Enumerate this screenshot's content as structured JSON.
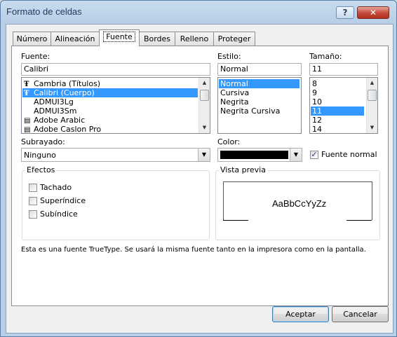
{
  "window": {
    "title": "Formato de celdas",
    "help_glyph": "?",
    "close_glyph": "✕"
  },
  "tabs": [
    "Número",
    "Alineación",
    "Fuente",
    "Bordes",
    "Relleno",
    "Proteger"
  ],
  "font": {
    "label": "Fuente:",
    "value": "Calibri",
    "items": [
      {
        "text": "Cambria (Títulos)",
        "icon": "truetype-icon",
        "glyph": "Ŧ",
        "selected": false
      },
      {
        "text": "Calibri (Cuerpo)",
        "icon": "truetype-icon",
        "glyph": "Ŧ",
        "selected": true
      },
      {
        "text": "ADMUI3Lg",
        "icon": "",
        "glyph": "",
        "selected": false
      },
      {
        "text": "ADMUI3Sm",
        "icon": "",
        "glyph": "",
        "selected": false
      },
      {
        "text": "Adobe Arabic",
        "icon": "printer-font-icon",
        "glyph": "▤",
        "selected": false
      },
      {
        "text": "Adobe Caslon Pro",
        "icon": "printer-font-icon",
        "glyph": "▤",
        "selected": false
      }
    ]
  },
  "style": {
    "label": "Estilo:",
    "value": "Normal",
    "items": [
      {
        "text": "Normal",
        "selected": true
      },
      {
        "text": "Cursiva",
        "selected": false
      },
      {
        "text": "Negrita",
        "selected": false
      },
      {
        "text": "Negrita Cursiva",
        "selected": false
      }
    ]
  },
  "size": {
    "label": "Tamaño:",
    "value": "11",
    "items": [
      {
        "text": "8",
        "selected": false
      },
      {
        "text": "9",
        "selected": false
      },
      {
        "text": "10",
        "selected": false
      },
      {
        "text": "11",
        "selected": true
      },
      {
        "text": "12",
        "selected": false
      },
      {
        "text": "14",
        "selected": false
      }
    ]
  },
  "underline": {
    "label": "Subrayado:",
    "value": "Ninguno"
  },
  "color": {
    "label": "Color:",
    "value_hex": "#000000"
  },
  "normal_font": {
    "label": "Fuente normal",
    "checked": true
  },
  "effects": {
    "title": "Efectos",
    "items": [
      {
        "label": "Tachado",
        "checked": false
      },
      {
        "label": "Superíndice",
        "checked": false
      },
      {
        "label": "Subíndice",
        "checked": false
      }
    ]
  },
  "preview": {
    "title": "Vista previa",
    "sample": "AaBbCcYyZz"
  },
  "info_text": "Esta es una fuente TrueType. Se usará la misma fuente tanto en la impresora como en la pantalla.",
  "buttons": {
    "ok": "Aceptar",
    "cancel": "Cancelar"
  },
  "colors": {
    "selection": "#3399ff",
    "close_button": "#c4473a"
  }
}
